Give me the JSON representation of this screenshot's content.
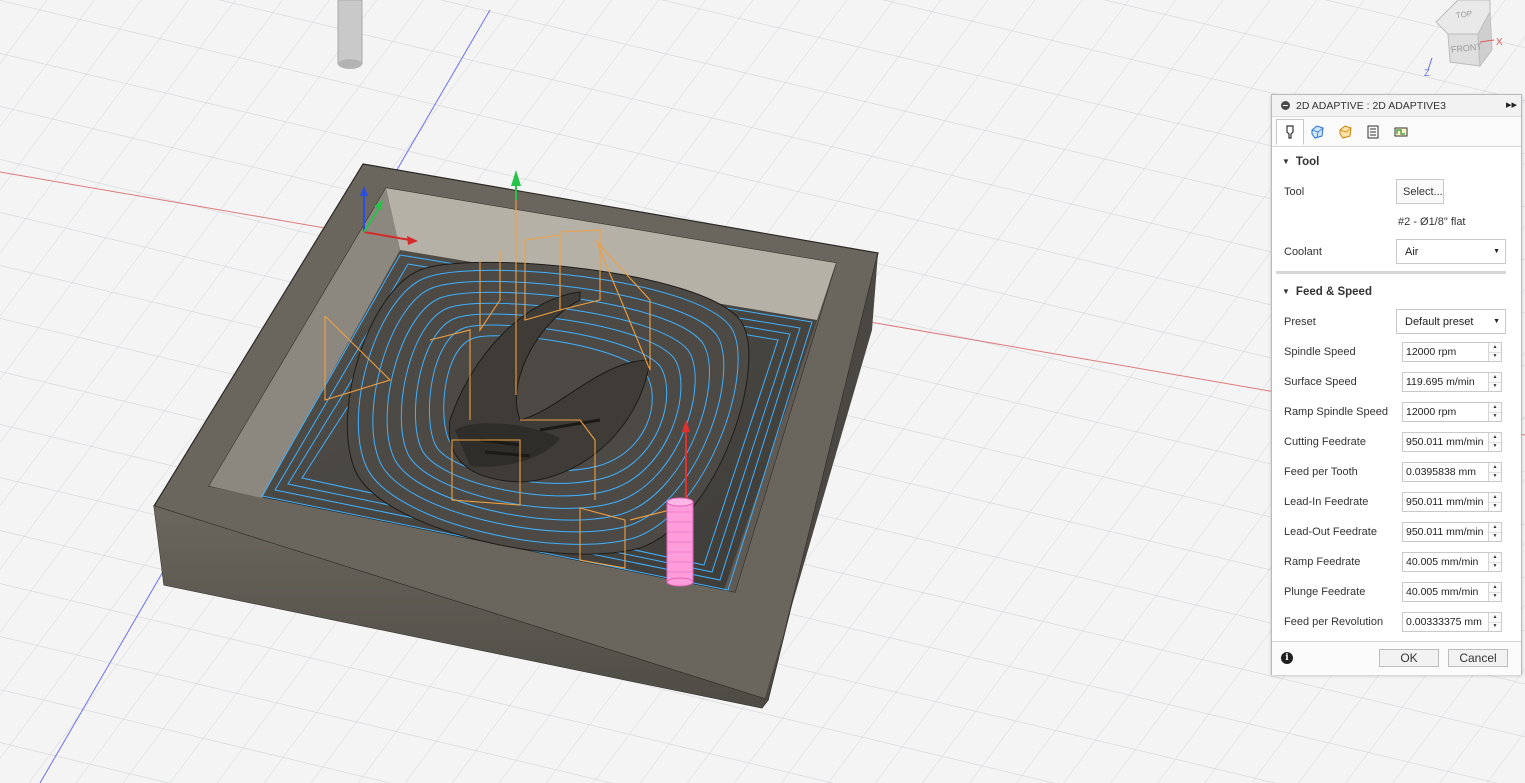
{
  "dialog": {
    "title": "2D ADAPTIVE : 2D ADAPTIVE3",
    "tabs": [
      {
        "icon": "tool-tab-icon"
      },
      {
        "icon": "geometry-tab-icon"
      },
      {
        "icon": "heights-tab-icon"
      },
      {
        "icon": "passes-tab-icon"
      },
      {
        "icon": "linking-tab-icon"
      }
    ],
    "tool_section": {
      "heading": "Tool",
      "tool_label": "Tool",
      "select_button": "Select...",
      "tool_info": "#2 - Ø1/8\" flat",
      "coolant_label": "Coolant",
      "coolant_value": "Air"
    },
    "feed_section": {
      "heading": "Feed & Speed",
      "preset_label": "Preset",
      "preset_value": "Default preset",
      "fields": [
        {
          "label": "Spindle Speed",
          "value": "12000 rpm"
        },
        {
          "label": "Surface Speed",
          "value": "119.695 m/min"
        },
        {
          "label": "Ramp Spindle Speed",
          "value": "12000 rpm"
        },
        {
          "label": "Cutting Feedrate",
          "value": "950.011 mm/min"
        },
        {
          "label": "Feed per Tooth",
          "value": "0.0395838 mm"
        },
        {
          "label": "Lead-In Feedrate",
          "value": "950.011 mm/min"
        },
        {
          "label": "Lead-Out Feedrate",
          "value": "950.011 mm/min"
        },
        {
          "label": "Ramp Feedrate",
          "value": "40.005 mm/min"
        },
        {
          "label": "Plunge Feedrate",
          "value": "40.005 mm/min"
        },
        {
          "label": "Feed per Revolution",
          "value": "0.00333375 mm"
        }
      ]
    },
    "ok_label": "OK",
    "cancel_label": "Cancel"
  },
  "viewcube": {
    "top_label": "TOP",
    "front_label": "FRONT",
    "x_axis": "X",
    "z_axis": "Z"
  },
  "colors": {
    "stock": "#5e5a52",
    "toolpath": "#3fb0ff",
    "rapid_moves": "#f0a040",
    "tool_preview": "#ff7fd0",
    "grid": "#c8ccd2"
  }
}
